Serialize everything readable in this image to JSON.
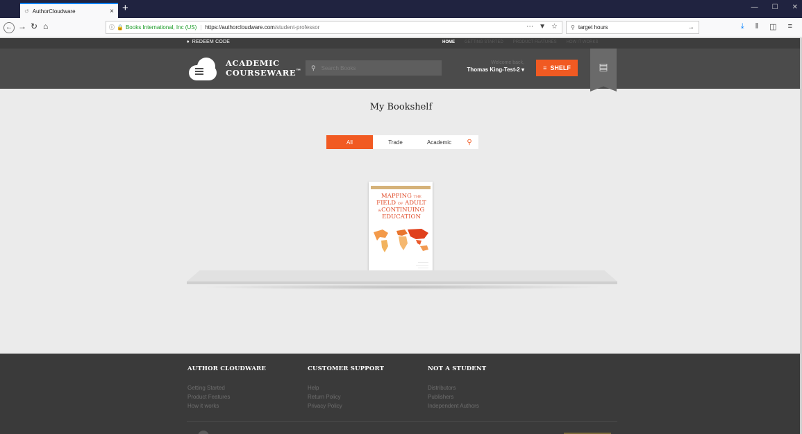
{
  "browser": {
    "tab_title": "AuthorCloudware",
    "tab_favicon": "↺",
    "tab_close": "×",
    "new_tab": "+",
    "url_org": "Books International, Inc (US)",
    "url_host": "https://authorcloudware.com",
    "url_path": "/student-professor",
    "search_value": "target hours"
  },
  "site": {
    "redeem_label": "REDEEM CODE",
    "nav": [
      "HOME",
      "GETTING STARTED",
      "PRODUCT FEATURES",
      "HOW IT WORKS"
    ],
    "logo_line1": "ACADEMIC",
    "logo_line2": "COURSEWARE",
    "logo_tm": "™",
    "search_placeholder": "Search Books",
    "welcome_text": "Welcome back,",
    "user_name": "Thomas King-Test-2 ▾",
    "shelf_label": "SHELF"
  },
  "main": {
    "page_title": "My Bookshelf",
    "filters": [
      "All",
      "Trade",
      "Academic"
    ],
    "active_filter": "All",
    "book": {
      "title_1": "MAPPING",
      "title_1b": "THE",
      "title_2a": "FIELD",
      "title_2b": "OF",
      "title_2c": "ADULT",
      "title_3a": "&",
      "title_3b": "CONTINUING",
      "title_4": "EDUCATION"
    }
  },
  "footer": {
    "col1": {
      "heading": "AUTHOR CLOUDWARE",
      "links": [
        "Getting Started",
        "Product Features",
        "How it works"
      ]
    },
    "col2": {
      "heading": "CUSTOMER SUPPORT",
      "links": [
        "Help",
        "Return Policy",
        "Privacy Policy"
      ]
    },
    "col3": {
      "heading": "NOT A STUDENT",
      "links": [
        "Distributors",
        "Publishers",
        "Independent Authors"
      ]
    }
  },
  "colors": {
    "accent": "#f15a22",
    "header": "#4b4b4b",
    "footer": "#3a3a3a",
    "page": "#ebebeb"
  }
}
